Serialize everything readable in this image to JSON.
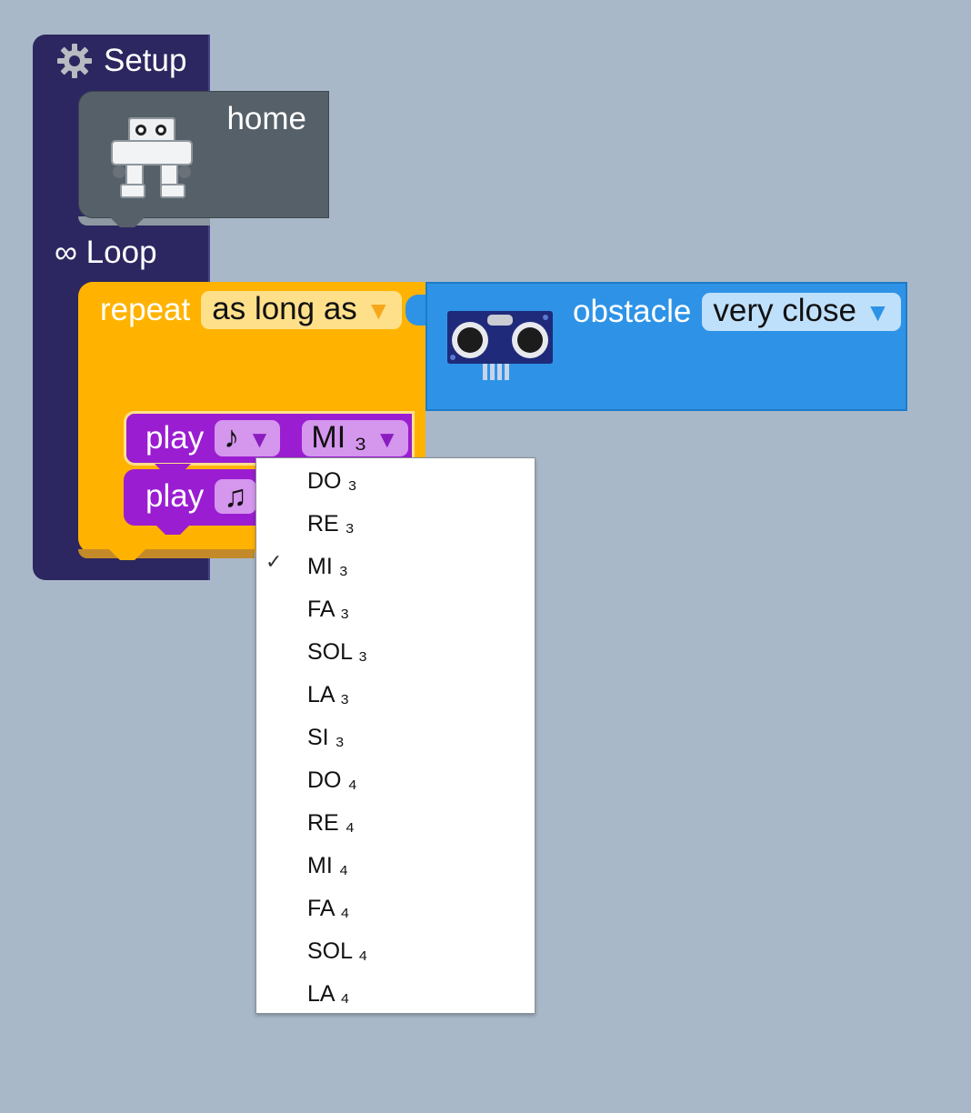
{
  "setup": {
    "label": "Setup",
    "icon": "gear-icon"
  },
  "home_block": {
    "label": "home",
    "icon": "robot-icon"
  },
  "loop": {
    "label": "∞ Loop"
  },
  "repeat_block": {
    "label": "repeat",
    "condition_mode": "as long as",
    "colors": {
      "block": "#ffb300",
      "field": "#ffe08a"
    }
  },
  "obstacle_block": {
    "label": "obstacle",
    "distance": "very close",
    "icon": "ultrasonic-sensor-icon",
    "colors": {
      "block": "#2e93e6"
    }
  },
  "play_blocks": [
    {
      "label": "play",
      "duration": "♪",
      "note": "MI ₃"
    },
    {
      "label": "play",
      "duration": "♫"
    }
  ],
  "note_dropdown": {
    "selected": "MI ₃",
    "check_mark": "✓",
    "options": [
      "DO ₃",
      "RE ₃",
      "MI ₃",
      "FA ₃",
      "SOL ₃",
      "LA ₃",
      "SI ₃",
      "DO ₄",
      "RE ₄",
      "MI ₄",
      "FA ₄",
      "SOL ₄",
      "LA ₄"
    ]
  },
  "colors": {
    "background": "#a9b8c9",
    "frame": "#2c2760",
    "play": "#9b1dd1"
  }
}
